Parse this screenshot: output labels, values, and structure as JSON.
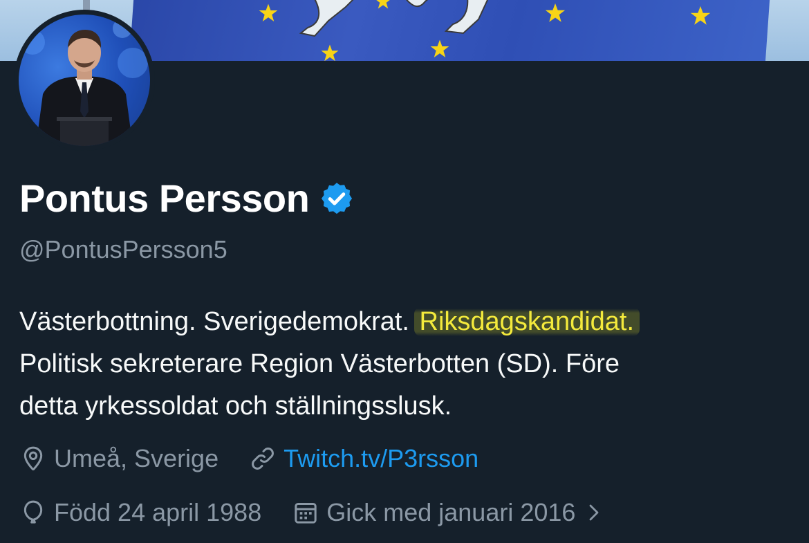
{
  "profile": {
    "name": "Pontus Persson",
    "verified": true,
    "handle": "@PontusPersson5",
    "bio": {
      "part1": "Västerbottning. Sverigedemokrat. ",
      "highlighted": "Riksdagskandidat.",
      "line2": "Politisk sekreterare Region Västerbotten (SD). Före",
      "line3": "detta yrkessoldat och ställningsslusk."
    },
    "location": "Umeå, Sverige",
    "website": "Twitch.tv/P3rsson",
    "birthday": "Född 24 april 1988",
    "joined": "Gick med januari 2016"
  },
  "colors": {
    "background": "#15202b",
    "secondary_text": "#8b98a5",
    "link": "#1d9bf0",
    "highlight": "#f4ea3c"
  },
  "icons": {
    "verified": "verified-badge-icon",
    "location": "location-pin-icon",
    "website": "link-icon",
    "birthday": "balloon-icon",
    "joined": "calendar-icon",
    "more": "chevron-right-icon"
  }
}
